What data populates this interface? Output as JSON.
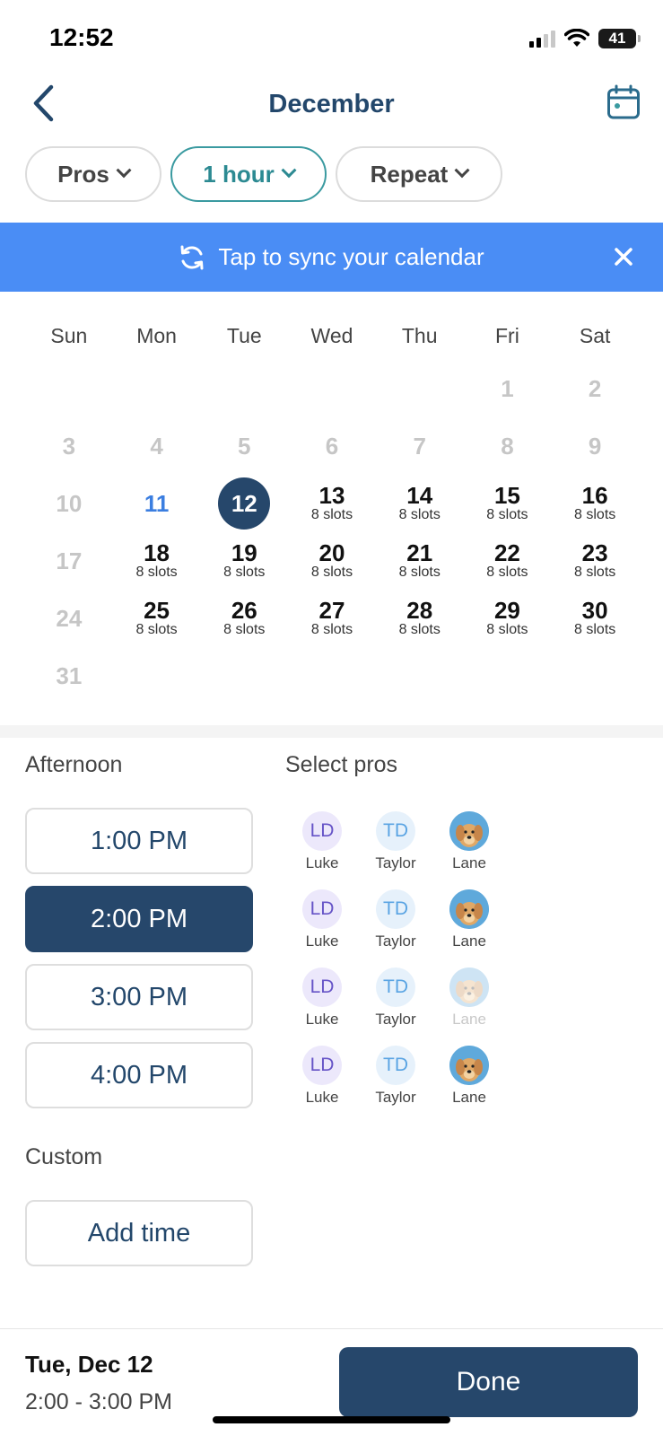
{
  "status_bar": {
    "time": "12:52",
    "battery": "41"
  },
  "header": {
    "title": "December"
  },
  "filters": [
    {
      "label": "Pros",
      "active": false
    },
    {
      "label": "1 hour",
      "active": true
    },
    {
      "label": "Repeat",
      "active": false
    }
  ],
  "banner": {
    "text": "Tap to sync your calendar"
  },
  "calendar": {
    "weekdays": [
      "Sun",
      "Mon",
      "Tue",
      "Wed",
      "Thu",
      "Fri",
      "Sat"
    ],
    "weeks": [
      [
        null,
        null,
        null,
        null,
        null,
        {
          "day": "1",
          "state": "muted"
        },
        {
          "day": "2",
          "state": "muted"
        }
      ],
      [
        {
          "day": "3",
          "state": "muted"
        },
        {
          "day": "4",
          "state": "muted"
        },
        {
          "day": "5",
          "state": "muted"
        },
        {
          "day": "6",
          "state": "muted"
        },
        {
          "day": "7",
          "state": "muted"
        },
        {
          "day": "8",
          "state": "muted"
        },
        {
          "day": "9",
          "state": "muted"
        }
      ],
      [
        {
          "day": "10",
          "state": "muted"
        },
        {
          "day": "11",
          "state": "today"
        },
        {
          "day": "12",
          "state": "selected"
        },
        {
          "day": "13",
          "slots": "8 slots"
        },
        {
          "day": "14",
          "slots": "8 slots"
        },
        {
          "day": "15",
          "slots": "8 slots"
        },
        {
          "day": "16",
          "slots": "8 slots"
        }
      ],
      [
        {
          "day": "17",
          "state": "muted"
        },
        {
          "day": "18",
          "slots": "8 slots"
        },
        {
          "day": "19",
          "slots": "8 slots"
        },
        {
          "day": "20",
          "slots": "8 slots"
        },
        {
          "day": "21",
          "slots": "8 slots"
        },
        {
          "day": "22",
          "slots": "8 slots"
        },
        {
          "day": "23",
          "slots": "8 slots"
        }
      ],
      [
        {
          "day": "24",
          "state": "muted"
        },
        {
          "day": "25",
          "slots": "8 slots"
        },
        {
          "day": "26",
          "slots": "8 slots"
        },
        {
          "day": "27",
          "slots": "8 slots"
        },
        {
          "day": "28",
          "slots": "8 slots"
        },
        {
          "day": "29",
          "slots": "8 slots"
        },
        {
          "day": "30",
          "slots": "8 slots"
        }
      ],
      [
        {
          "day": "31",
          "state": "muted"
        },
        null,
        null,
        null,
        null,
        null,
        null
      ]
    ]
  },
  "sections": {
    "afternoon": "Afternoon",
    "select_pros": "Select pros",
    "custom": "Custom"
  },
  "times": [
    {
      "label": "1:00 PM",
      "selected": false
    },
    {
      "label": "2:00 PM",
      "selected": true
    },
    {
      "label": "3:00 PM",
      "selected": false
    },
    {
      "label": "4:00 PM",
      "selected": false
    }
  ],
  "pro_rows": [
    [
      {
        "initials": "LD",
        "name": "Luke",
        "kind": "ld"
      },
      {
        "initials": "TD",
        "name": "Taylor",
        "kind": "td"
      },
      {
        "initials": "",
        "name": "Lane",
        "kind": "dog"
      }
    ],
    [
      {
        "initials": "LD",
        "name": "Luke",
        "kind": "ld"
      },
      {
        "initials": "TD",
        "name": "Taylor",
        "kind": "td"
      },
      {
        "initials": "",
        "name": "Lane",
        "kind": "dog"
      }
    ],
    [
      {
        "initials": "LD",
        "name": "Luke",
        "kind": "ld"
      },
      {
        "initials": "TD",
        "name": "Taylor",
        "kind": "td"
      },
      {
        "initials": "",
        "name": "Lane",
        "kind": "dog",
        "dim": true
      }
    ],
    [
      {
        "initials": "LD",
        "name": "Luke",
        "kind": "ld"
      },
      {
        "initials": "TD",
        "name": "Taylor",
        "kind": "td"
      },
      {
        "initials": "",
        "name": "Lane",
        "kind": "dog"
      }
    ]
  ],
  "add_time": "Add time",
  "footer": {
    "date": "Tue, Dec 12",
    "range": "2:00 - 3:00 PM",
    "done": "Done"
  }
}
